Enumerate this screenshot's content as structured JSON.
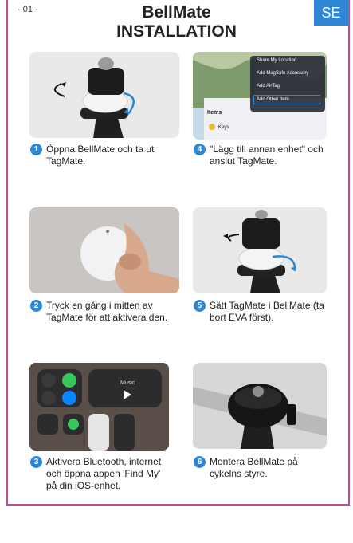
{
  "header": {
    "page_number": "· 01 ·",
    "title_line1": "BellMate",
    "title_line2": "INSTALLATION",
    "language": "SE"
  },
  "colors": {
    "accent_blue": "#2e86d4",
    "frame_magenta": "#c04c9c"
  },
  "steps": [
    {
      "number": "1",
      "caption": "Öppna BellMate och ta ut TagMate."
    },
    {
      "number": "4",
      "caption": "\"Lägg till annan enhet\" och anslut TagMate."
    },
    {
      "number": "2",
      "caption": "Tryck en gång i mitten av TagMate för att aktivera den."
    },
    {
      "number": "5",
      "caption": "Sätt TagMate i BellMate (ta bort EVA först)."
    },
    {
      "number": "3",
      "caption": "Aktivera Bluetooth, internet och öppna appen 'Find My' på din iOS-enhet."
    },
    {
      "number": "6",
      "caption": "Montera BellMate på cykelns styre."
    }
  ],
  "phone_menu": {
    "items": [
      "Share My Location",
      "Add MagSafe Accessory",
      "Add AirTag",
      "Add Other Item"
    ],
    "section": "Items",
    "row": "Keys"
  },
  "control_center": {
    "music_label": "Music"
  }
}
